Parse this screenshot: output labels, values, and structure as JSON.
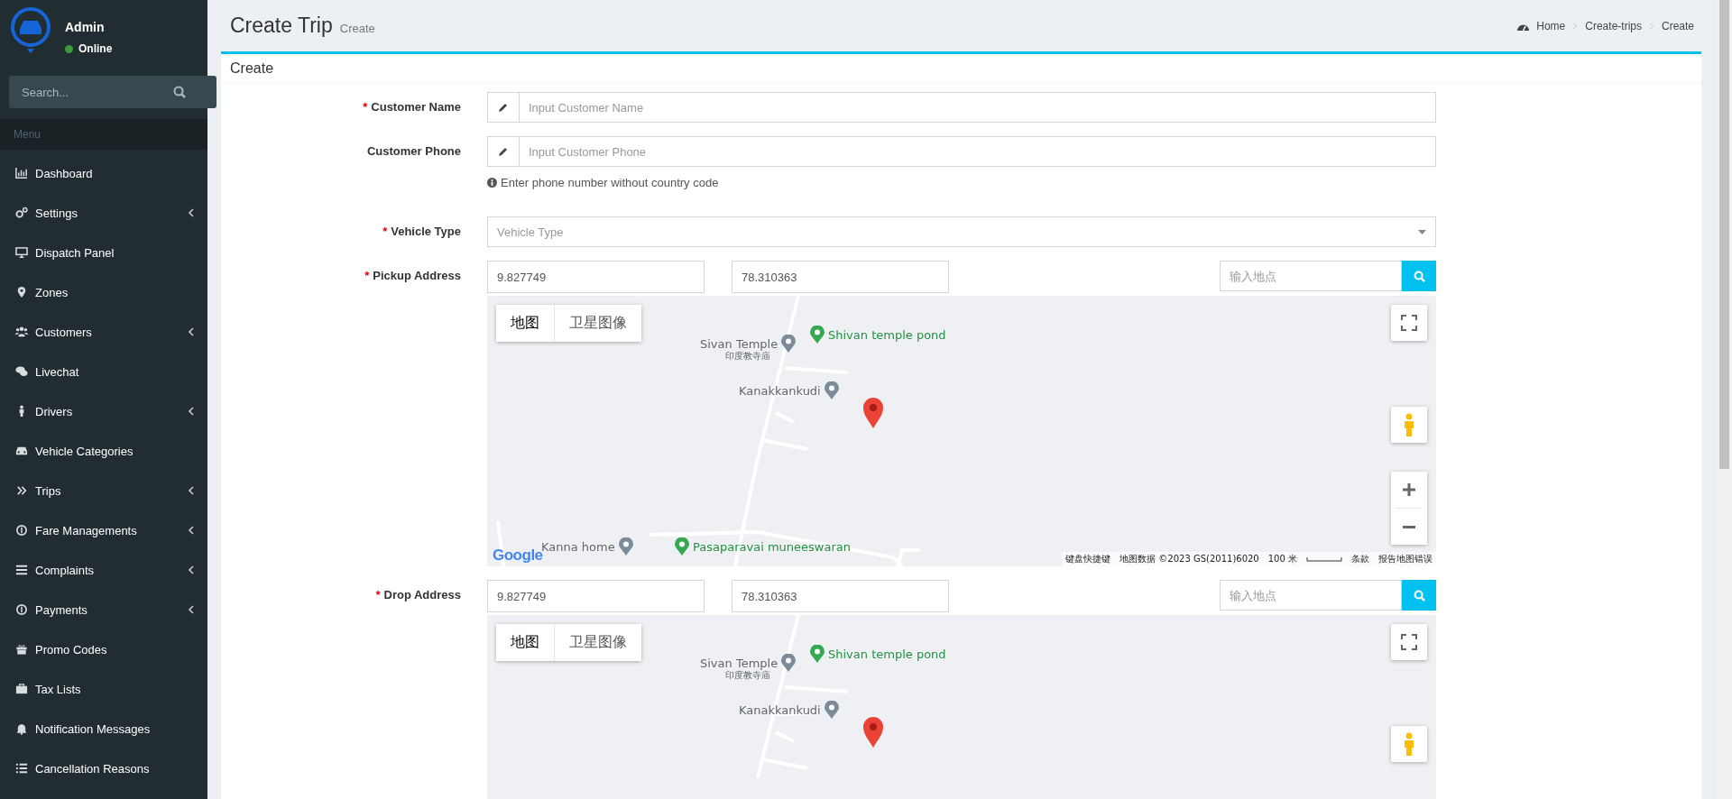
{
  "sidebar": {
    "user": {
      "name": "Admin",
      "status": "Online"
    },
    "search": {
      "placeholder": "Search..."
    },
    "menu_header": "Menu",
    "items": [
      {
        "label": "Dashboard",
        "expandable": false
      },
      {
        "label": "Settings",
        "expandable": true
      },
      {
        "label": "Dispatch Panel",
        "expandable": false
      },
      {
        "label": "Zones",
        "expandable": false
      },
      {
        "label": "Customers",
        "expandable": true
      },
      {
        "label": "Livechat",
        "expandable": false
      },
      {
        "label": "Drivers",
        "expandable": true
      },
      {
        "label": "Vehicle Categories",
        "expandable": false
      },
      {
        "label": "Trips",
        "expandable": true
      },
      {
        "label": "Fare Managements",
        "expandable": true
      },
      {
        "label": "Complaints",
        "expandable": true
      },
      {
        "label": "Payments",
        "expandable": true
      },
      {
        "label": "Promo Codes",
        "expandable": false
      },
      {
        "label": "Tax Lists",
        "expandable": false
      },
      {
        "label": "Notification Messages",
        "expandable": false
      },
      {
        "label": "Cancellation Reasons",
        "expandable": false
      }
    ]
  },
  "header": {
    "title": "Create Trip",
    "subtitle": "Create",
    "breadcrumb": [
      "Home",
      "Create-trips",
      "Create"
    ]
  },
  "box": {
    "title": "Create",
    "required_mark": "*",
    "fields": [
      {
        "kind": "text",
        "label": "Customer Name",
        "required": true,
        "placeholder": "Input Customer Name"
      },
      {
        "kind": "text",
        "label": "Customer Phone",
        "required": false,
        "placeholder": "Input Customer Phone",
        "help": "Enter phone number without country code"
      },
      {
        "kind": "select",
        "label": "Vehicle Type",
        "required": true,
        "placeholder": "Vehicle Type"
      },
      {
        "kind": "address",
        "label": "Pickup Address",
        "required": true,
        "lat": "9.827749",
        "lng": "78.310363",
        "search_placeholder": "输入地点",
        "map": {
          "map_types": [
            {
              "label": "地图",
              "selected": true
            },
            {
              "label": "卫星图像",
              "selected": false
            }
          ],
          "places": [
            {
              "name": "Shivan temple pond",
              "kind": "park"
            },
            {
              "name": "Sivan Temple",
              "note": "印度教寺庙",
              "kind": "temple"
            },
            {
              "name": "Kanakkankudi",
              "kind": "temple"
            },
            {
              "name": "Kanna home",
              "kind": "poi"
            },
            {
              "name": "Pasaparavai muneeswaran",
              "kind": "park"
            }
          ],
          "zoom_controls": true,
          "logo": "Google",
          "footer": [
            "键盘快捷键",
            "地图数据 ©2023 GS(2011)6020"
          ],
          "scale": "100 米",
          "footer_links": [
            "条款",
            "报告地图错误"
          ]
        }
      },
      {
        "kind": "address",
        "label": "Drop Address",
        "required": true,
        "lat": "9.827749",
        "lng": "78.310363",
        "search_placeholder": "输入地点",
        "map": {
          "map_types": [
            {
              "label": "地图",
              "selected": true
            },
            {
              "label": "卫星图像",
              "selected": false
            }
          ],
          "places": [
            {
              "name": "Shivan temple pond",
              "kind": "park"
            },
            {
              "name": "Sivan Temple",
              "note": "印度教寺庙",
              "kind": "temple"
            },
            {
              "name": "Kanakkankudi",
              "kind": "temple"
            }
          ],
          "zoom_controls": false
        }
      }
    ]
  }
}
